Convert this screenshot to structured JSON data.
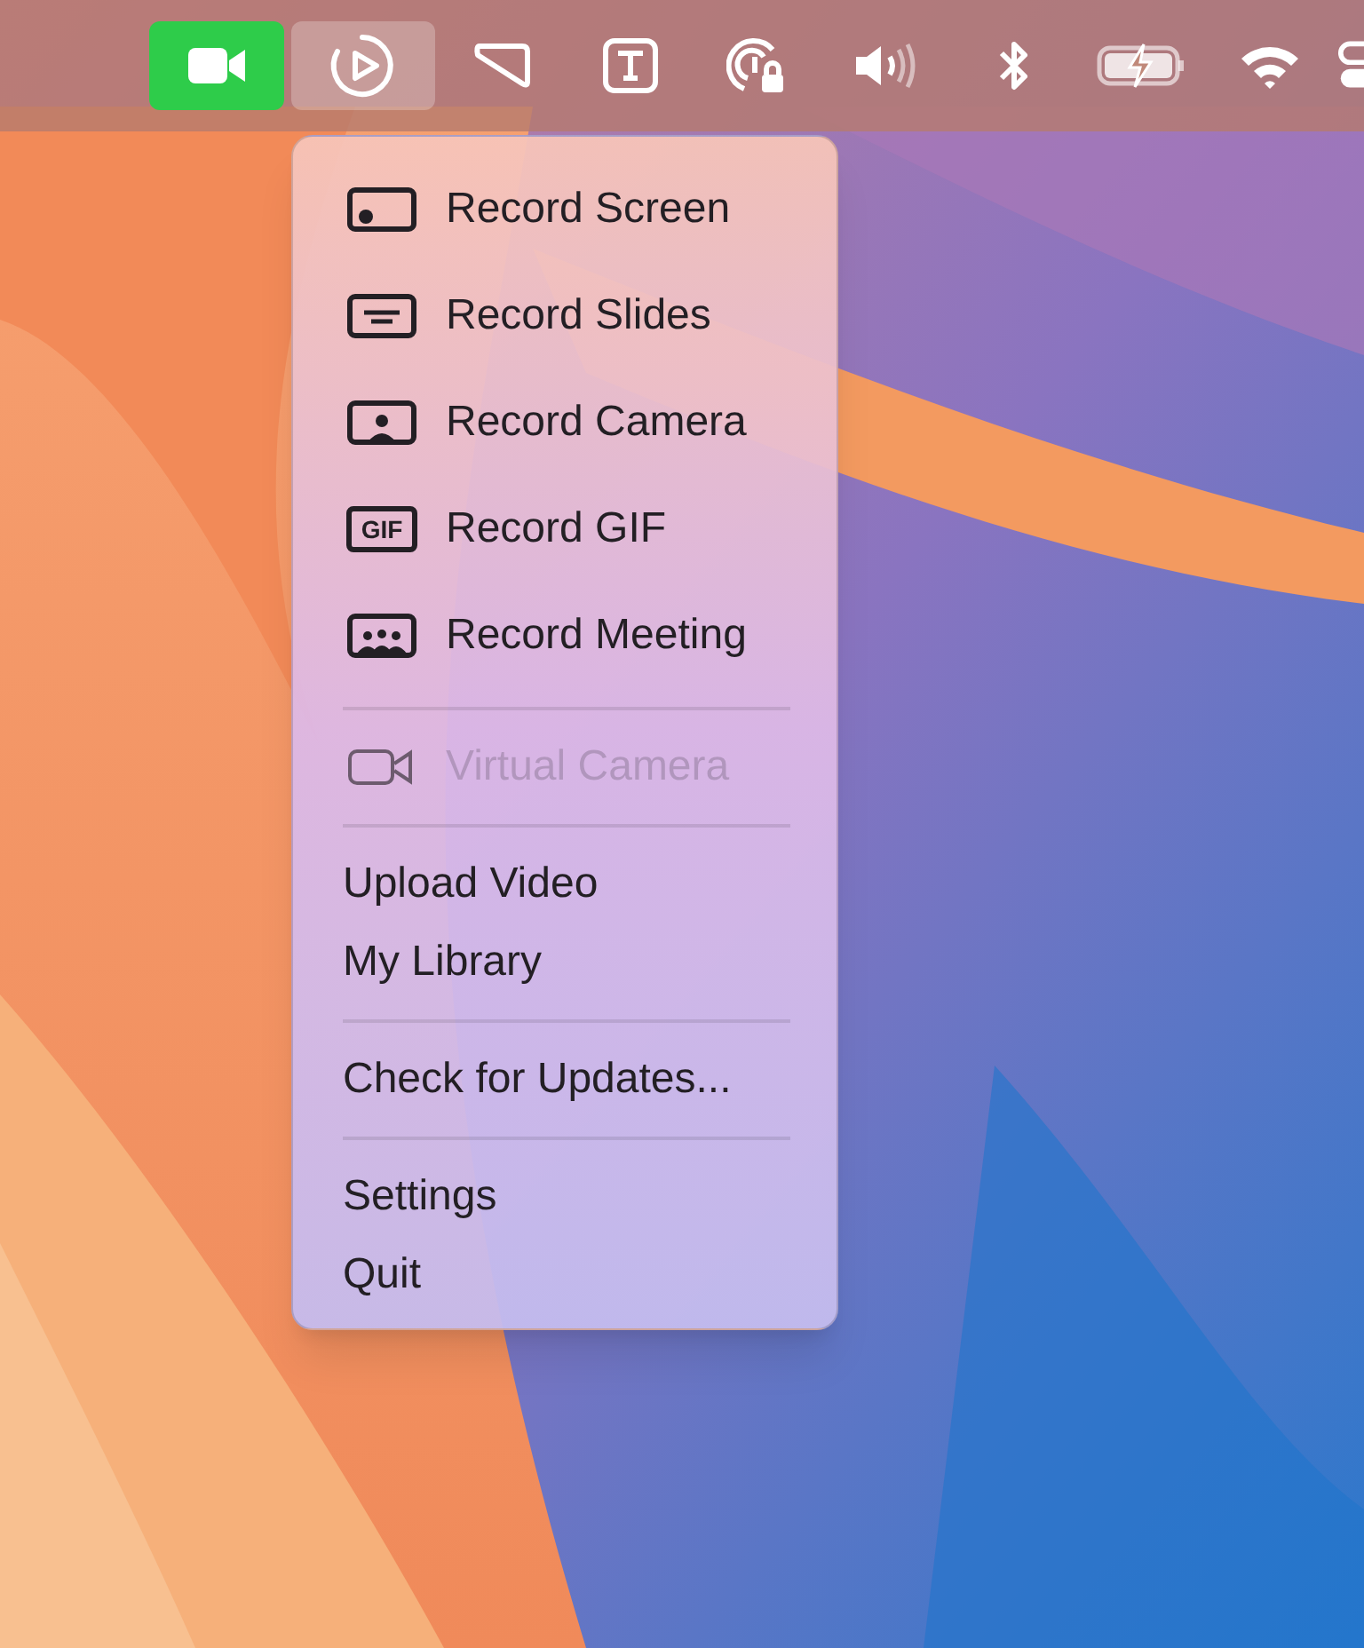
{
  "menu_bar": {
    "items": [
      {
        "kind": "camera_app",
        "selected": false
      },
      {
        "kind": "recorder",
        "selected": true
      },
      {
        "kind": "shape_app",
        "selected": false
      },
      {
        "kind": "text_app",
        "selected": false
      },
      {
        "kind": "hotspot_lock",
        "selected": false
      },
      {
        "kind": "volume",
        "selected": false
      },
      {
        "kind": "bluetooth",
        "selected": false
      },
      {
        "kind": "battery",
        "selected": false
      },
      {
        "kind": "wifi",
        "selected": false
      },
      {
        "kind": "control_center",
        "selected": false
      }
    ]
  },
  "menu": {
    "items": [
      {
        "kind": "icon_item",
        "label": "Record Screen",
        "disabled": false
      },
      {
        "kind": "icon_item",
        "label": "Record Slides",
        "disabled": false
      },
      {
        "kind": "icon_item",
        "label": "Record Camera",
        "disabled": false
      },
      {
        "kind": "icon_item",
        "label": "Record GIF",
        "icon_label": "GIF",
        "disabled": false
      },
      {
        "kind": "icon_item",
        "label": "Record Meeting",
        "disabled": false
      },
      {
        "kind": "separator"
      },
      {
        "kind": "icon_item",
        "label": "Virtual Camera",
        "disabled": true
      },
      {
        "kind": "separator"
      },
      {
        "kind": "text_item",
        "label": "Upload Video",
        "disabled": false
      },
      {
        "kind": "text_item",
        "label": "My Library",
        "disabled": false
      },
      {
        "kind": "separator"
      },
      {
        "kind": "text_item",
        "label": "Check for Updates...",
        "disabled": false
      },
      {
        "kind": "separator"
      },
      {
        "kind": "text_item",
        "label": "Settings",
        "disabled": false
      },
      {
        "kind": "text_item",
        "label": "Quit",
        "disabled": false
      }
    ]
  }
}
